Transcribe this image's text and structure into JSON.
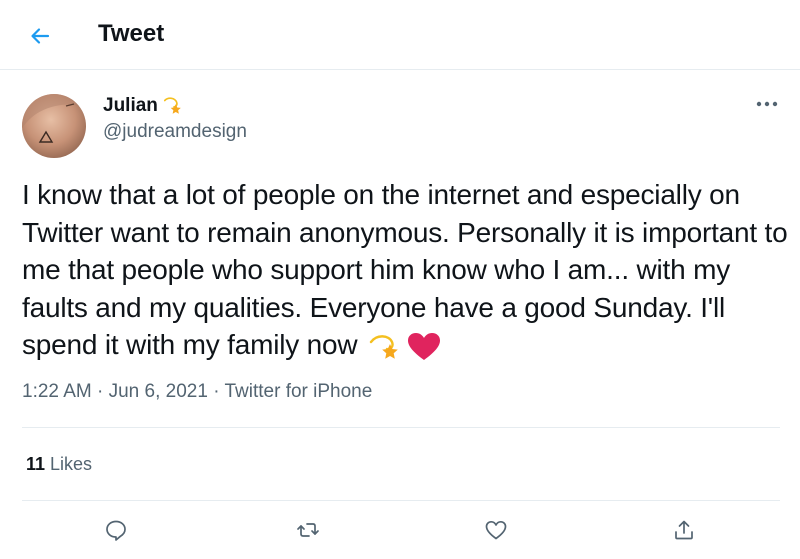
{
  "header": {
    "title": "Tweet"
  },
  "colors": {
    "accent": "#1d9bf0",
    "text": "#0f1419",
    "secondary": "#536471",
    "divider": "#e6ecf0",
    "heart": "#e0245e"
  },
  "tweet": {
    "author": {
      "name": "Julian",
      "name_emoji_icon": "dizzy-star-icon",
      "handle": "@judreamdesign"
    },
    "text": "I know that a lot of people on the internet and especially on Twitter want to remain anonymous. Personally it is important to me that people who support him know who I am... with my faults and my qualities. Everyone have a good Sunday. I'll spend it with my family now",
    "text_emoji_icons": [
      "dizzy-star-icon",
      "red-heart-icon"
    ],
    "time": "1:22 AM",
    "separator": " · ",
    "date": "Jun 6, 2021",
    "source": "Twitter for iPhone",
    "likes_count": "11",
    "likes_label": " Likes"
  },
  "actions": [
    "reply-icon",
    "retweet-icon",
    "like-icon",
    "share-icon"
  ]
}
